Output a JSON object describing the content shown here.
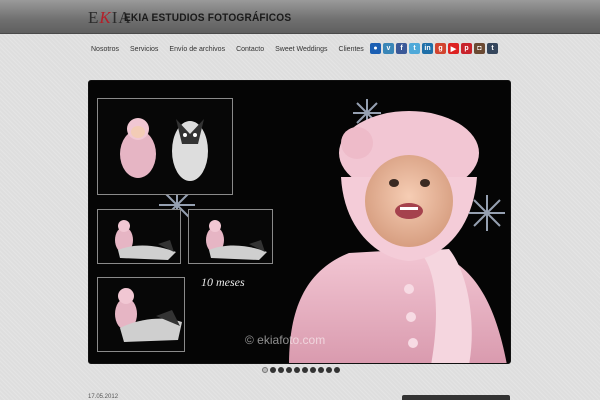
{
  "header": {
    "logo_text": "EKIA",
    "site_title": "EKIA ESTUDIOS FOTOGRÁFICOS"
  },
  "nav": {
    "items": [
      "Nosotros",
      "Servicios",
      "Envío de archivos",
      "Contacto",
      "Sweet Weddings",
      "Clientes"
    ]
  },
  "social": [
    {
      "name": "flickr-icon",
      "glyph": "●",
      "color": "#1b5fb3"
    },
    {
      "name": "vimeo-icon",
      "glyph": "v",
      "color": "#3a86b7"
    },
    {
      "name": "facebook-icon",
      "glyph": "f",
      "color": "#3b5998"
    },
    {
      "name": "twitter-icon",
      "glyph": "t",
      "color": "#4fa9d9"
    },
    {
      "name": "linkedin-icon",
      "glyph": "in",
      "color": "#1f6fa8"
    },
    {
      "name": "google-plus-icon",
      "glyph": "g",
      "color": "#d1442f"
    },
    {
      "name": "youtube-icon",
      "glyph": "▶",
      "color": "#d22"
    },
    {
      "name": "pinterest-icon",
      "glyph": "p",
      "color": "#c8232c"
    },
    {
      "name": "instagram-icon",
      "glyph": "◘",
      "color": "#6b4a33"
    },
    {
      "name": "tumblr-icon",
      "glyph": "t",
      "color": "#35465c"
    }
  ],
  "slider": {
    "caption": "10 meses",
    "watermark": "© ekiafoto.com",
    "slide_count": 10,
    "active_slide": 1
  },
  "footer": {
    "date": "17.05.2012"
  }
}
